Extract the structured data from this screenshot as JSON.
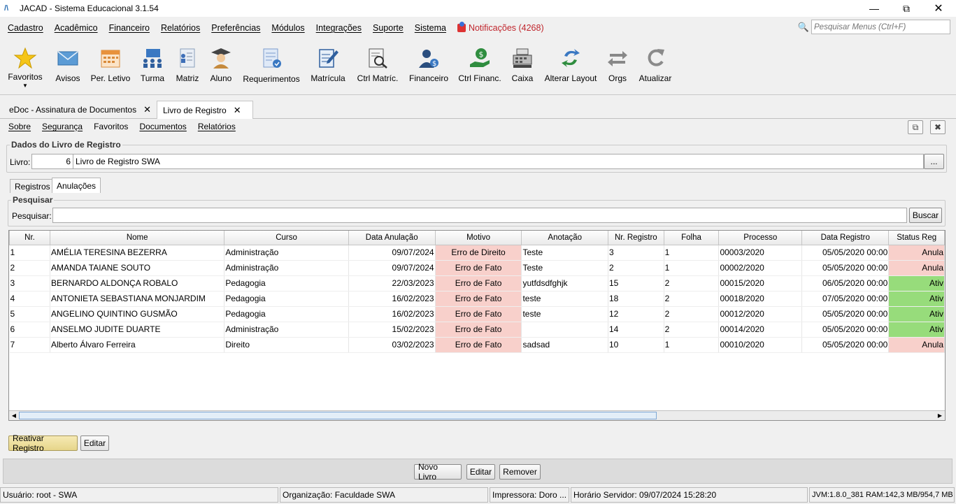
{
  "window": {
    "title": "JACAD - Sistema Educacional 3.1.54"
  },
  "menu": {
    "items": [
      "Cadastro",
      "Acadêmico",
      "Financeiro",
      "Relatórios",
      "Preferências",
      "Módulos",
      "Integrações",
      "Suporte",
      "Sistema"
    ],
    "notifications": "Notificações (4268)",
    "search_placeholder": "Pesquisar Menus (Ctrl+F)"
  },
  "toolbar": {
    "favoritos": "Favoritos",
    "avisos": "Avisos",
    "per_letivo": "Per. Letivo",
    "turma": "Turma",
    "matriz": "Matriz",
    "aluno": "Aluno",
    "requerimentos": "Requerimentos",
    "matricula": "Matrícula",
    "ctrl_matric": "Ctrl Matríc.",
    "financeiro": "Financeiro",
    "ctrl_financ": "Ctrl Financ.",
    "caixa": "Caixa",
    "alterar_layout": "Alterar Layout",
    "orgs": "Orgs",
    "atualizar": "Atualizar"
  },
  "tabs": [
    {
      "label": "eDoc - Assinatura de Documentos"
    },
    {
      "label": "Livro de Registro"
    }
  ],
  "submenu": [
    "Sobre",
    "Segurança",
    "Favoritos",
    "Documentos",
    "Relatórios"
  ],
  "dados": {
    "legend": "Dados do Livro de Registro",
    "livro_label": "Livro:",
    "livro_num": "6",
    "livro_nome": "Livro de Registro SWA",
    "browse": "..."
  },
  "subtabs": [
    "Registros",
    "Anulações"
  ],
  "pesquisar": {
    "legend": "Pesquisar",
    "label": "Pesquisar:",
    "value": "",
    "button": "Buscar"
  },
  "table": {
    "headers": [
      "Nr.",
      "Nome",
      "Curso",
      "Data Anulação",
      "Motivo",
      "Anotação",
      "Nr. Registro",
      "Folha",
      "Processo",
      "Data Registro",
      "Status Reg"
    ],
    "rows": [
      [
        "1",
        "AMÉLIA TERESINA BEZERRA",
        "Administração",
        "09/07/2024",
        "Erro de Direito",
        "Teste",
        "3",
        "1",
        "00003/2020",
        "05/05/2020 00:00",
        "Anula"
      ],
      [
        "2",
        "AMANDA TAIANE SOUTO",
        "Administração",
        "09/07/2024",
        "Erro de Fato",
        "Teste",
        "2",
        "1",
        "00002/2020",
        "05/05/2020 00:00",
        "Anula"
      ],
      [
        "3",
        "BERNARDO ALDONÇA ROBALO",
        "Pedagogia",
        "22/03/2023",
        "Erro de Fato",
        "yutfdsdfghjk",
        "15",
        "2",
        "00015/2020",
        "06/05/2020 00:00",
        "Ativ"
      ],
      [
        "4",
        "ANTONIETA SEBASTIANA MONJARDIM",
        "Pedagogia",
        "16/02/2023",
        "Erro de Fato",
        "teste",
        "18",
        "2",
        "00018/2020",
        "07/05/2020 00:00",
        "Ativ"
      ],
      [
        "5",
        "ANGELINO QUINTINO GUSMÃO",
        "Pedagogia",
        "16/02/2023",
        "Erro de Fato",
        "teste",
        "12",
        "2",
        "00012/2020",
        "05/05/2020 00:00",
        "Ativ"
      ],
      [
        "6",
        "ANSELMO JUDITE DUARTE",
        "Administração",
        "15/02/2023",
        "Erro de Fato",
        "",
        "14",
        "2",
        "00014/2020",
        "05/05/2020 00:00",
        "Ativ"
      ],
      [
        "7",
        "Alberto Álvaro Ferreira",
        "Direito",
        "03/02/2023",
        "Erro de Fato",
        "sadsad",
        "10",
        "1",
        "00010/2020",
        "05/05/2020 00:00",
        "Anula"
      ]
    ],
    "status_colors": {
      "Anula": "#f8d0cb",
      "Ativ": "#97dc7b"
    }
  },
  "actions": {
    "reativar": "Reativar Registro",
    "editar": "Editar"
  },
  "bottom": {
    "novo_livro": "Novo Livro",
    "editar": "Editar",
    "remover": "Remover"
  },
  "status": {
    "usuario": "Usuário: root - SWA",
    "organizacao": "Organização: Faculdade SWA",
    "impressora": "Impressora: Doro ...",
    "horario": "Horário Servidor: 09/07/2024 15:28:20",
    "jvm": "JVM:1.8.0_381  RAM:142,3 MB/954,7 MB"
  }
}
